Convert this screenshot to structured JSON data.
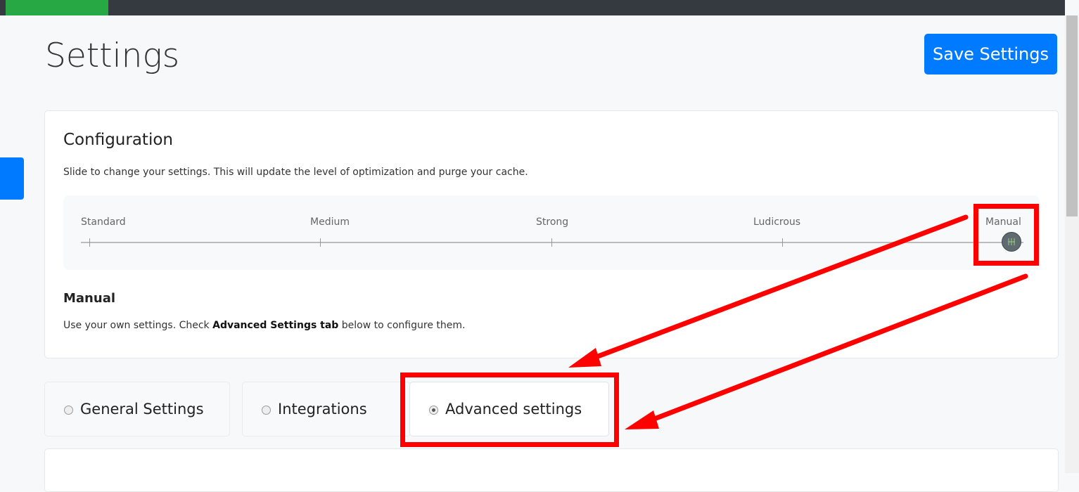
{
  "header": {
    "title": "Settings",
    "save_label": "Save Settings"
  },
  "configuration": {
    "title": "Configuration",
    "description": "Slide to change your settings. This will update the level of optimization and purge your cache.",
    "levels": [
      "Standard",
      "Medium",
      "Strong",
      "Ludicrous",
      "Manual"
    ],
    "selected_level": "Manual",
    "selected_index": 4,
    "mode_title": "Manual",
    "mode_desc_before": "Use your own settings. Check ",
    "mode_desc_bold": "Advanced Settings tab",
    "mode_desc_after": " below to configure them."
  },
  "tabs": [
    {
      "label": "General Settings",
      "selected": false
    },
    {
      "label": "Integrations",
      "selected": false
    },
    {
      "label": "Advanced settings",
      "selected": true
    }
  ],
  "colors": {
    "annotation": "#ff0000",
    "primary": "#007bff",
    "success": "#28a745",
    "topbar": "#343a40"
  }
}
